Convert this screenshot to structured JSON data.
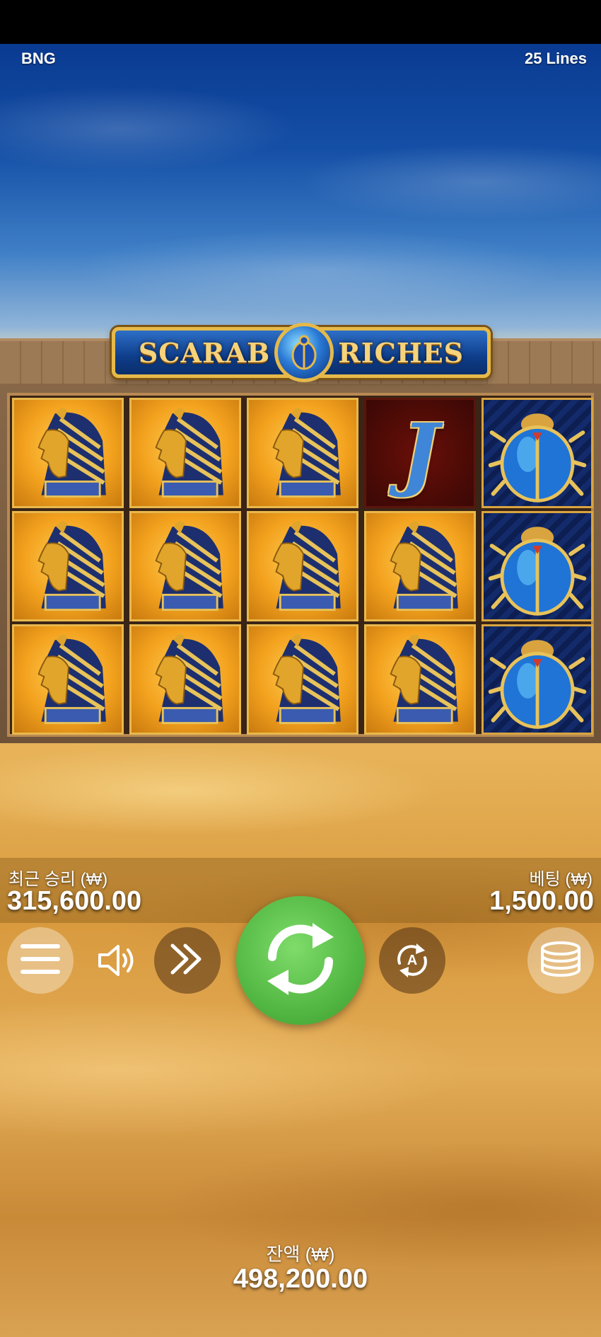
{
  "header": {
    "provider": "BNG",
    "lines": "25 Lines"
  },
  "logo": {
    "left_word": "SCARAB",
    "right_word": "RICHES"
  },
  "reels": {
    "columns": [
      [
        "pharaoh",
        "pharaoh",
        "pharaoh"
      ],
      [
        "pharaoh",
        "pharaoh",
        "pharaoh"
      ],
      [
        "pharaoh",
        "pharaoh",
        "pharaoh"
      ],
      [
        "jack",
        "pharaoh",
        "pharaoh"
      ],
      [
        "scarab",
        "scarab",
        "scarab"
      ]
    ],
    "jack_letter": "J"
  },
  "stats": {
    "last_win_label": "최근 승리 (₩)",
    "last_win_value": "315,600.00",
    "bet_label": "베팅 (₩)",
    "bet_value": "1,500.00",
    "balance_label": "잔액 (₩)",
    "balance_value": "498,200.00"
  },
  "controls": {
    "menu_icon": "menu-icon",
    "sound_icon": "speaker-icon",
    "turbo_icon": "fast-forward-icon",
    "spin_icon": "spin-arrows-icon",
    "autoplay_icon": "autoplay-icon",
    "autoplay_glyph": "A",
    "bet_icon": "coin-stack-icon"
  },
  "colors": {
    "spin_button": "#53b843",
    "frame_gold": "#e9b84c"
  }
}
